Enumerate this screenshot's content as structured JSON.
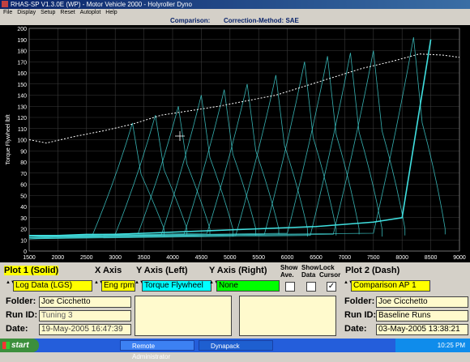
{
  "window": {
    "title": "RHAS-SP V1.3.0E (WP) - Motor Vehicle 2000 - Holyroller Dyno"
  },
  "menu": [
    "File",
    "Display",
    "Setup",
    "Reset",
    "Autoplot",
    "Help"
  ],
  "header": {
    "comparison_label": "Comparison:",
    "correction_label": "Correction-Method: SAE"
  },
  "chart_data": {
    "type": "line",
    "ylabel": "Torque Flywheel lbft",
    "xlim": [
      1500,
      9000
    ],
    "ylim": [
      0,
      200
    ],
    "x_ticks": [
      1500,
      2000,
      2500,
      3000,
      3500,
      4000,
      4500,
      5000,
      5500,
      6000,
      6500,
      7000,
      7500,
      8000,
      8500,
      9000
    ],
    "y_ticks": [
      0,
      10,
      20,
      30,
      40,
      50,
      60,
      70,
      80,
      90,
      100,
      110,
      120,
      130,
      140,
      150,
      160,
      170,
      180,
      190,
      200
    ],
    "grid": true,
    "series": [
      {
        "style": "dash",
        "color": "#ffffff",
        "x": [
          1500,
          1800,
          2300,
          2800,
          3300,
          3800,
          4300,
          4800,
          5300,
          5800,
          6300,
          6800,
          7300,
          7800,
          8300,
          8700,
          9000
        ],
        "values": [
          100,
          97,
          103,
          108,
          114,
          122,
          126,
          130,
          135,
          140,
          148,
          156,
          164,
          170,
          177,
          176,
          174
        ]
      },
      {
        "style": "solid",
        "color": "#40e0e0",
        "x": [
          1500,
          2000,
          2500,
          3000,
          3500,
          4000,
          4500,
          5000,
          5500,
          6000,
          6500,
          7000,
          7500,
          8000,
          8500
        ],
        "values": [
          14,
          14,
          15,
          15,
          16,
          17,
          18,
          19,
          20,
          21,
          22,
          24,
          26,
          30,
          190
        ]
      }
    ]
  },
  "panel": {
    "plot1_label": "Plot 1 (Solid)",
    "xaxis_label": "X Axis",
    "yleft_label": "Y Axis (Left)",
    "yright_label": "Y Axis (Right)",
    "show_ave": "Show Ave.",
    "show_data": "Show Data",
    "lock_cursor": "Lock Cursor",
    "plot2_label": "Plot 2 (Dash)",
    "plot1_source": "Log Data (LGS)",
    "xaxis_value": "Eng rpm",
    "yleft_value": "Torque Flywheel",
    "yright_value": "None",
    "plot2_source": "Comparison AP 1",
    "folder_label": "Folder:",
    "runid_label": "Run ID:",
    "date_label": "Date:",
    "plot1_folder": "Joe Cicchetto",
    "plot1_runid": "Tuning 3",
    "plot1_date": "19-May-2005  16:47:39",
    "plot2_folder": "Joe Cicchetto",
    "plot2_runid": "Baseline Runs",
    "plot2_date": "03-May-2005  13:38:21",
    "lock_cursor_checked": "✓"
  },
  "taskbar": {
    "start": "start",
    "tasks": [
      "Remote Administrator",
      "Dynapack"
    ],
    "clock": "10:25 PM"
  }
}
